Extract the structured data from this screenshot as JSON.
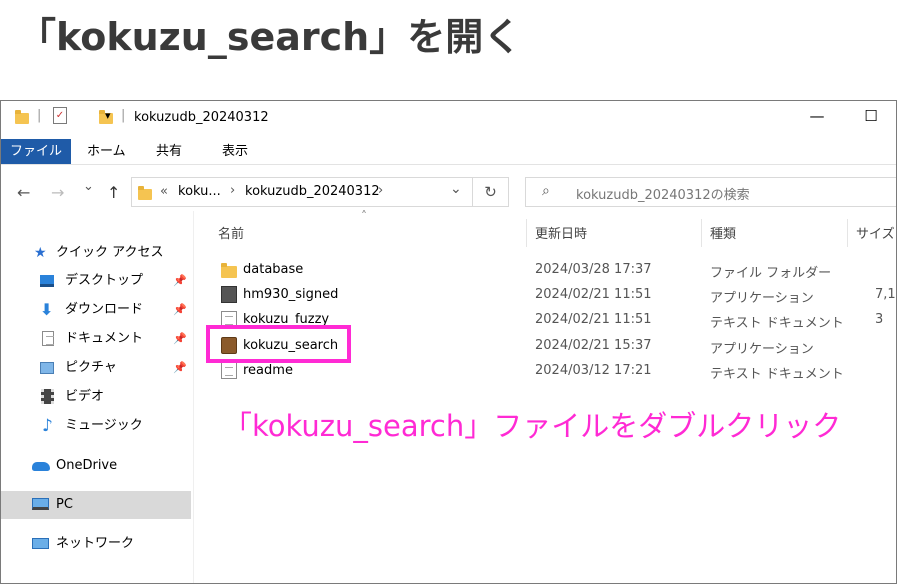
{
  "heading": "「kokuzu_search」を開く",
  "window": {
    "title": "kokuzudb_20240312",
    "minimize": "—",
    "maximize": "☐"
  },
  "ribbon": {
    "tabs": [
      "ファイル",
      "ホーム",
      "共有",
      "表示"
    ]
  },
  "address": {
    "back": "←",
    "forward": "→",
    "recent": "⌄",
    "up": "↑",
    "crumbs": [
      "«",
      "koku...",
      "›",
      "kokuzudb_20240312",
      "›"
    ],
    "dropdown": "⌄",
    "refresh": "↻",
    "search_placeholder": "kokuzudb_20240312の検索"
  },
  "nav": {
    "quick_access": "クイック アクセス",
    "items": [
      {
        "label": "デスクトップ",
        "pinned": true
      },
      {
        "label": "ダウンロード",
        "pinned": true
      },
      {
        "label": "ドキュメント",
        "pinned": true
      },
      {
        "label": "ピクチャ",
        "pinned": true
      },
      {
        "label": "ビデオ",
        "pinned": false
      },
      {
        "label": "ミュージック",
        "pinned": false
      }
    ],
    "onedrive": "OneDrive",
    "pc": "PC",
    "network": "ネットワーク"
  },
  "columns": {
    "name": "名前",
    "date": "更新日時",
    "type": "種類",
    "size": "サイズ"
  },
  "files": [
    {
      "name": "database",
      "date": "2024/03/28 17:37",
      "type": "ファイル フォルダー",
      "size": "",
      "icon": "folder-icon"
    },
    {
      "name": "hm930_signed",
      "date": "2024/02/21 11:51",
      "type": "アプリケーション",
      "size": "7,1",
      "icon": "application-icon"
    },
    {
      "name": "kokuzu_fuzzy",
      "date": "2024/02/21 11:51",
      "type": "テキスト ドキュメント",
      "size": "3",
      "icon": "text-document-icon"
    },
    {
      "name": "kokuzu_search",
      "date": "2024/02/21 15:37",
      "type": "アプリケーション",
      "size": "",
      "icon": "kokuzu-app-icon"
    },
    {
      "name": "readme",
      "date": "2024/03/12 17:21",
      "type": "テキスト ドキュメント",
      "size": "",
      "icon": "text-document-icon"
    }
  ],
  "callout": "「kokuzu_search」ファイルをダブルクリック",
  "colors": {
    "highlight": "#ff2ad4",
    "file_tab": "#1f5ba8",
    "folder": "#f5c451"
  }
}
